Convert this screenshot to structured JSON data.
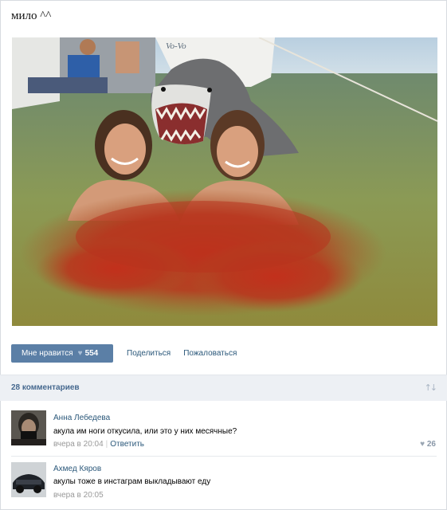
{
  "post": {
    "text": "мило ^^",
    "photo_alt": "photo"
  },
  "actions": {
    "like_label": "Мне нравится",
    "like_icon": "heart-icon",
    "like_count": "554",
    "share_label": "Поделиться",
    "report_label": "Пожаловаться"
  },
  "comments_header": {
    "count_label": "28 комментариев",
    "sort_icon": "sort-icon"
  },
  "comments": [
    {
      "author": "Анна Лебедева",
      "text": "акула им ноги откусила, или это у них месячные?",
      "time": "вчера в 20:04",
      "reply_label": "Ответить",
      "likes": "26"
    },
    {
      "author": "Ахмед Кяров",
      "text": "акулы тоже в инстаграм выкладывают еду",
      "time": "вчера в 20:05"
    }
  ],
  "colors": {
    "button_bg": "#5b7fa6",
    "link": "#2b587a",
    "header_bg": "#edf0f4"
  }
}
